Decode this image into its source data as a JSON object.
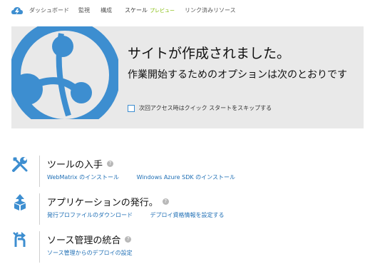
{
  "nav": {
    "items": [
      "ダッシュボード",
      "監視",
      "構成",
      "スケール",
      "リンク済みリソース"
    ],
    "preview_badge": "プレビュー"
  },
  "banner": {
    "title": "サイトが作成されました。",
    "subtitle": "作業開始するためのオプションは次のとおりです",
    "skip_label": "次回アクセス時はクイック スタートをスキップする",
    "skip_checked": false
  },
  "sections": [
    {
      "icon": "tools-icon",
      "title": "ツールの入手",
      "links": [
        "WebMatrix のインストール",
        "Windows Azure SDK のインストール"
      ]
    },
    {
      "icon": "publish-icon",
      "title": "アプリケーションの発行。",
      "links": [
        "発行プロファイルのダウンロード",
        "デプロイ資格情報を設定する"
      ]
    },
    {
      "icon": "source-control-icon",
      "title": "ソース管理の統合",
      "links": [
        "ソース管理からのデプロイの設定"
      ]
    }
  ],
  "colors": {
    "accent": "#3d8ed0",
    "link": "#1f6fb5",
    "preview": "#7fba00",
    "banner_bg": "#e9e9e9"
  }
}
